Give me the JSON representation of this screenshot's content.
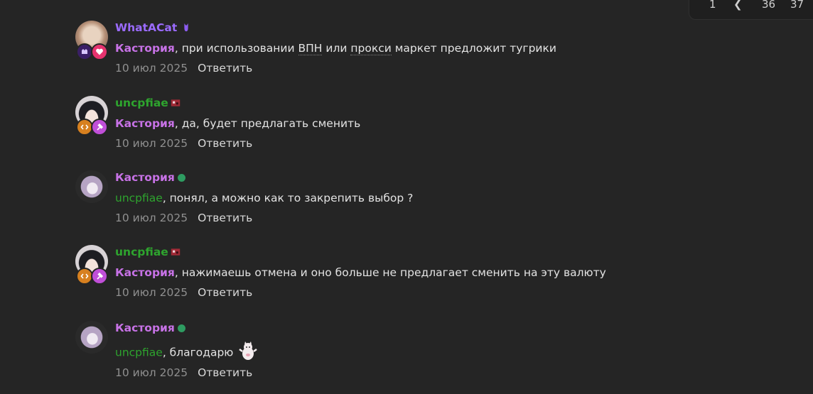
{
  "pagination": {
    "first": "1",
    "prev": "❮",
    "page_a": "36",
    "page_b": "37"
  },
  "colors": {
    "background": "#252525",
    "whatacat": "#9b6bff",
    "kastoria": "#c772e6",
    "uncpfiae": "#2ea42e",
    "online": "#2e9c61"
  },
  "comments": [
    {
      "author": "WhatACat",
      "mention": "Кастория",
      "text_parts": [
        ", при использовании ",
        "ВПН",
        " или ",
        "прокси",
        " маркет предложит тугрики"
      ],
      "date": "10 июл 2025",
      "reply": "Ответить"
    },
    {
      "author": "uncpfiae",
      "mention": "Кастория",
      "text": ", да, будет предлагать сменить",
      "date": "10 июл 2025",
      "reply": "Ответить"
    },
    {
      "author": "Кастория",
      "mention": "uncpfiae",
      "text": ", понял, а можно как то закрепить выбор ?",
      "date": "10 июл 2025",
      "reply": "Ответить"
    },
    {
      "author": "uncpfiae",
      "mention": "Кастория",
      "text": ", нажимаешь отмена и оно больше не предлагает сменить на эту валюту",
      "date": "10 июл 2025",
      "reply": "Ответить"
    },
    {
      "author": "Кастория",
      "mention": "uncpfiae",
      "text": ", благодарю",
      "date": "10 июл 2025",
      "reply": "Ответить"
    }
  ]
}
